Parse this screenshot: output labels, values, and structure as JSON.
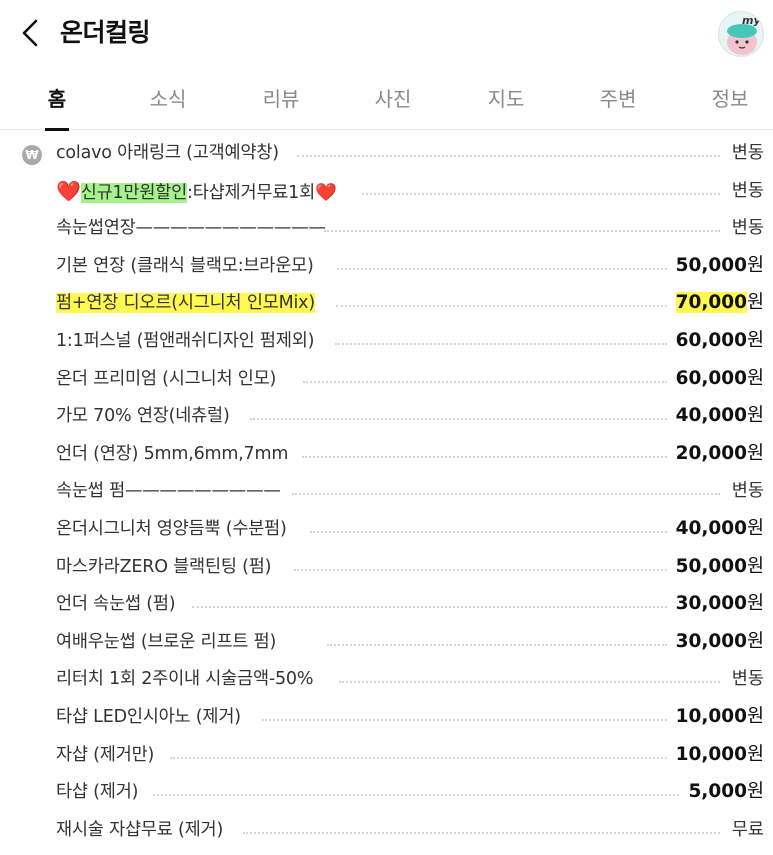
{
  "header": {
    "title": "온더컬링",
    "avatar_badge": "my"
  },
  "tabs": [
    "홈",
    "소식",
    "리뷰",
    "사진",
    "지도",
    "주변",
    "정보"
  ],
  "active_tab": "홈",
  "menu": [
    {
      "name": "colavo 아래링크 (고객예약창)",
      "price": "변동",
      "icon": "won-icon"
    },
    {
      "name_pre": "❤️",
      "name_hl": "신규1만원할인",
      "name_post": ":타샵제거무료1회❤️",
      "price": "변동"
    },
    {
      "name": "속눈썹연장———————————",
      "price": "변동"
    },
    {
      "name": "기본 연장 (클래식 블랙모:브라운모)",
      "price_num": "50,000",
      "unit": "원"
    },
    {
      "name": "펌+연장 디오르(시그니처 인모Mix)",
      "price_num": "70,000",
      "unit": "원",
      "highlight": true
    },
    {
      "name": "1:1퍼스널 (펌앤래쉬디자인 펌제외)",
      "price_num": "60,000",
      "unit": "원"
    },
    {
      "name": "온더 프리미엄 (시그니처 인모)",
      "price_num": "60,000",
      "unit": "원"
    },
    {
      "name": "가모 70% 연장(네츄럴)",
      "price_num": "40,000",
      "unit": "원"
    },
    {
      "name": "언더 (연장) 5mm,6mm,7mm",
      "price_num": "20,000",
      "unit": "원"
    },
    {
      "name": "속눈썹 펌—————————",
      "price": "변동"
    },
    {
      "name": "온더시그니처 영양듬뿍 (수분펌)",
      "price_num": "40,000",
      "unit": "원"
    },
    {
      "name": "마스카라ZERO 블랙틴팅 (펌)",
      "price_num": "50,000",
      "unit": "원"
    },
    {
      "name": "언더 속눈썹 (펌)",
      "price_num": "30,000",
      "unit": "원"
    },
    {
      "name": "여배우눈썹 (브로운 리프트 펌)",
      "price_num": "30,000",
      "unit": "원"
    },
    {
      "name": "리터치 1회 2주이내 시술금액-50%",
      "price": "변동"
    },
    {
      "name": "타샵 LED인시아노 (제거)",
      "price_num": "10,000",
      "unit": "원"
    },
    {
      "name": "자샵 (제거만)",
      "price_num": "10,000",
      "unit": "원"
    },
    {
      "name": "타샵 (제거)",
      "price_num": "5,000",
      "unit": "원"
    },
    {
      "name": "재시술 자샵무료 (제거)",
      "price": "무료"
    }
  ],
  "colors": {
    "highlight_yellow": "#fff84f",
    "highlight_green": "#a6f28a",
    "heart_red": "#d4061b"
  }
}
